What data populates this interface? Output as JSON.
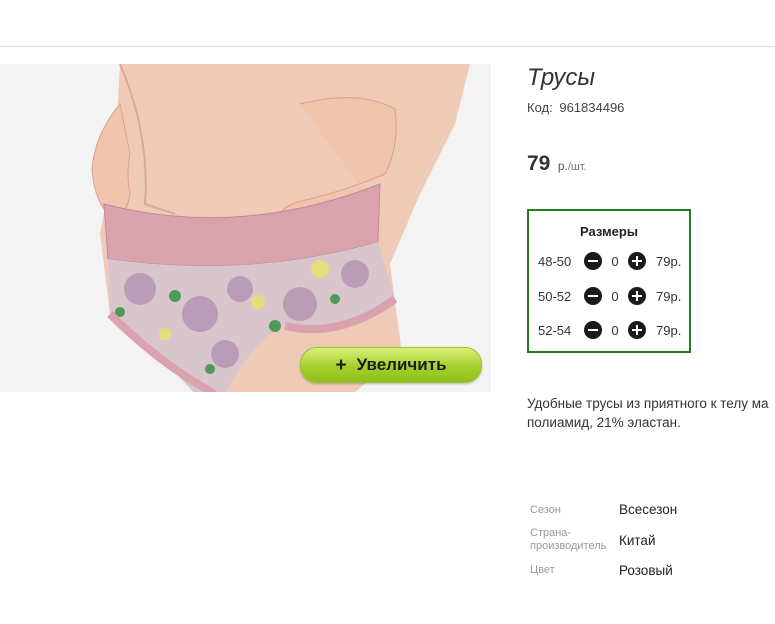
{
  "product": {
    "title": "Трусы",
    "sku_label": "Код:",
    "sku_value": "961834496",
    "price_value": "79",
    "price_unit": "р.",
    "price_per": "/шт."
  },
  "zoom_button": {
    "icon": "+",
    "label": "Увеличить"
  },
  "sizes": {
    "header": "Размеры",
    "rows": [
      {
        "size": "48-50",
        "qty": "0",
        "price": "79р."
      },
      {
        "size": "50-52",
        "qty": "0",
        "price": "79р."
      },
      {
        "size": "52-54",
        "qty": "0",
        "price": "79р."
      }
    ]
  },
  "description": {
    "line1": "Удобные трусы из приятного к телу ма",
    "line2": "полиамид, 21% эластан."
  },
  "properties": [
    {
      "key": "Сезон",
      "value": "Всесезон"
    },
    {
      "key": "Страна-производитель",
      "value": "Китай"
    },
    {
      "key": "Цвет",
      "value": "Розовый"
    }
  ],
  "colors": {
    "accent_border": "#1e7d1e",
    "button_green": "#a6cf2b"
  }
}
